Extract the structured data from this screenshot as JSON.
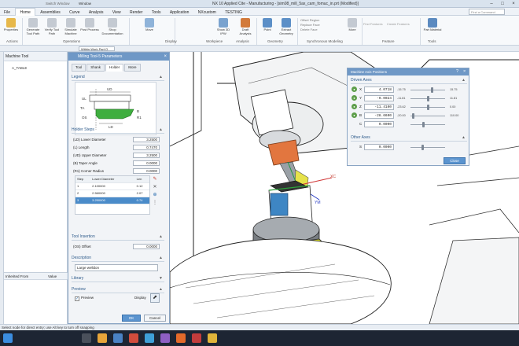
{
  "app": {
    "title": "NX 10 Applied Cite - Manufacturing - [sim08_mill_5ax_cam_fomuc_in.prt (Modified)]",
    "window_menu": "Window",
    "quick_access": "Switch Window"
  },
  "menu": {
    "items": [
      "File",
      "Home",
      "Assemblies",
      "Curve",
      "Analysis",
      "View",
      "Render",
      "Tools",
      "Application",
      "NXcustom",
      "TESTING"
    ],
    "active_index": 1,
    "find_command_placeholder": "Find a Command"
  },
  "ribbon": {
    "buttons": [
      {
        "label": "Properties",
        "icon": "properties-icon"
      },
      {
        "label": "Generate Tool Path",
        "icon": "generate-icon"
      },
      {
        "label": "Verify Tool Path",
        "icon": "verify-icon"
      },
      {
        "label": "Simulate Machine",
        "icon": "simulate-icon"
      },
      {
        "label": "Post Process",
        "icon": "post-icon"
      },
      {
        "label": "Shop Documentation",
        "icon": "shopdoc-icon"
      },
      {
        "label": "Move",
        "icon": "move-icon"
      },
      {
        "label": "Show 3D IPW",
        "icon": "ipw-icon"
      },
      {
        "label": "Draft Analysis",
        "icon": "draft-icon"
      },
      {
        "label": "Point",
        "icon": "point-icon"
      },
      {
        "label": "Extract Geometry",
        "icon": "extract-icon"
      },
      {
        "label": "More",
        "icon": "more-icon"
      },
      {
        "label": "Part Material",
        "icon": "material-icon"
      }
    ],
    "small_items": [
      "Offset Region",
      "Replace Face",
      "Delete Face",
      "Find Features",
      "Create Features",
      "Feature Groups"
    ],
    "groups": [
      "Actions",
      "Operations",
      "Display",
      "Workpiece",
      "Analysis",
      "Geometry",
      "Synchronous Modeling",
      "Feature",
      "Tools"
    ]
  },
  "resource_bar": {
    "filter_label": "Within Work Part O"
  },
  "nav": {
    "header": "Machine Tool",
    "tree_root": "A_TABLE",
    "tree_rows": [
      "",
      "",
      "",
      "",
      "",
      "",
      "",
      "",
      "",
      "",
      "",
      "",
      "",
      "",
      "",
      "",
      "",
      "",
      "",
      "",
      "",
      "",
      "",
      "",
      "",
      "",
      "",
      "",
      ""
    ],
    "grid_header_1": "Inherited From",
    "grid_header_2": "Value"
  },
  "dialog": {
    "title": "Milling Tool-5 Parameters",
    "tabs": [
      "Tool",
      "Shank",
      "Holder",
      "More"
    ],
    "active_tab": 2,
    "legend_section": "Legend",
    "legend_labels": [
      "UD",
      "UL",
      "TA",
      "OS",
      "LD",
      "B",
      "R1"
    ],
    "holder_section": "Holder Steps",
    "fields": [
      {
        "label": "(LD) Lower Diameter",
        "value": "3.2500"
      },
      {
        "label": "(L) Length",
        "value": "0.7470"
      },
      {
        "label": "(UD) Upper Diameter",
        "value": "3.2500"
      },
      {
        "label": "(B) Taper Angle",
        "value": "0.0000"
      },
      {
        "label": "(R1) Corner Radius",
        "value": "0.0000"
      }
    ],
    "step_table": {
      "headers": [
        "Step",
        "Lower Diameter",
        "Len"
      ],
      "rows": [
        [
          "1",
          "2.100000",
          "0.12"
        ],
        [
          "2",
          "2.560000",
          "2.07"
        ],
        [
          "3",
          "3.250000",
          "0.74"
        ]
      ],
      "selected_row": 2
    },
    "tool_insertion_section": "Tool Insertion",
    "offset_label": "(OS) Offset",
    "offset_value": "0.0000",
    "description_section": "Description",
    "description_value": "Large welldon",
    "library_section": "Library",
    "preview_section": "Preview",
    "preview_checkbox": "Preview",
    "display_label": "Display",
    "ok_label": "OK",
    "cancel_label": "Cancel"
  },
  "map_dialog": {
    "title": "Machine Axis Positions",
    "driven_section": "Driven Axes",
    "axes": [
      {
        "name": "X",
        "value": "4.0718",
        "min": "-15.75",
        "max": "15.75",
        "pos": 0.63
      },
      {
        "name": "Y",
        "value": "-0.0024",
        "min": "-11.81",
        "max": "11.81",
        "pos": 0.5
      },
      {
        "name": "Z",
        "value": "-11.4100",
        "min": "-23.62",
        "max": "0.00",
        "pos": 0.52
      },
      {
        "name": "B",
        "value": "-28.6600",
        "min": "-20.00",
        "max": "110.00",
        "pos": 0.07
      },
      {
        "name": "C",
        "value": "0.0000",
        "min": "",
        "max": "",
        "pos": 0.38
      }
    ],
    "other_section": "Other Axes",
    "other_axes": [
      {
        "name": "S",
        "value": "0.0000",
        "pos": 0.35
      }
    ],
    "close_label": "Close"
  },
  "viewport": {
    "axis_labels": [
      "XC",
      "YM"
    ]
  },
  "status": {
    "text": "Select node for direct entry; use Alt key to turn off snapping"
  },
  "taskbar": {
    "time": "",
    "date": ""
  }
}
